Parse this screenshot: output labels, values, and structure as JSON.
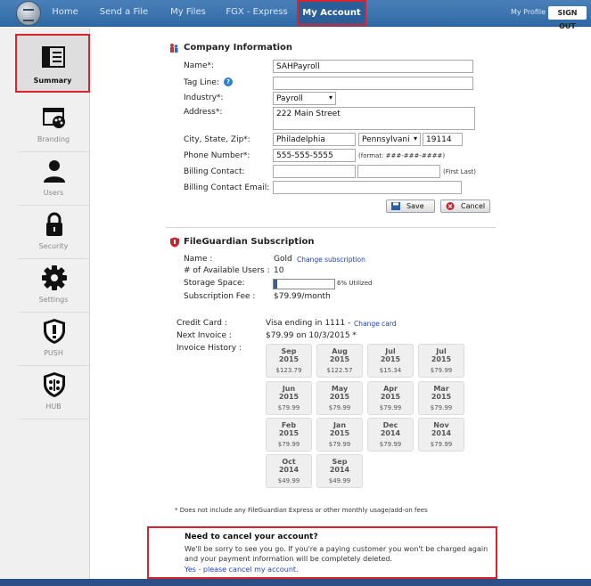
{
  "nav": {
    "items": [
      "Home",
      "Send a File",
      "My Files",
      "FGX - Express",
      "My Account"
    ],
    "active": "My Account",
    "my_profile": "My Profile",
    "sign_out": "SIGN OUT"
  },
  "sidebar": {
    "items": [
      {
        "label": "Summary",
        "icon": "summary-icon"
      },
      {
        "label": "Branding",
        "icon": "branding-icon"
      },
      {
        "label": "Users",
        "icon": "users-icon"
      },
      {
        "label": "Security",
        "icon": "lock-icon"
      },
      {
        "label": "Settings",
        "icon": "gear-icon"
      },
      {
        "label": "PUSH",
        "icon": "push-shield-icon"
      },
      {
        "label": "HUB",
        "icon": "hub-shield-icon"
      }
    ]
  },
  "company": {
    "title": "Company Information",
    "name_label": "Name*:",
    "name_value": "SAHPayroll",
    "tagline_label": "Tag Line:",
    "tagline_value": "",
    "industry_label": "Industry*:",
    "industry_value": "Payroll",
    "address_label": "Address*:",
    "address_value": "222 Main Street",
    "city_label": "City, State, Zip*:",
    "city_value": "Philadelphia",
    "state_value": "Pennsylvani",
    "zip_value": "19114",
    "phone_label": "Phone Number*:",
    "phone_value": "555-555-5555",
    "phone_hint": "(format: ###-###-####)",
    "billing_contact_label": "Billing Contact:",
    "billing_contact_hint": "(First Last)",
    "billing_email_label": "Billing Contact Email:",
    "save_label": "Save",
    "cancel_label": "Cancel"
  },
  "subscription": {
    "title": "FileGuardian Subscription",
    "name_label": "Name :",
    "name_value": "Gold",
    "change_link": "Change subscription",
    "users_label": "# of Available Users :",
    "users_value": "10",
    "storage_label": "Storage Space:",
    "storage_fraction": 0.06,
    "storage_text": "6% Utilized",
    "fee_label": "Subscription Fee :",
    "fee_value": "$79.99/month",
    "card_label": "Credit Card :",
    "card_value": "Visa ending in 1111 -",
    "card_link": "Change card",
    "next_label": "Next Invoice :",
    "next_value": "$79.99 on 10/3/2015 *",
    "history_label": "Invoice History :"
  },
  "invoices": [
    {
      "month": "Sep",
      "year": "2015",
      "amount": "$123.79"
    },
    {
      "month": "Aug",
      "year": "2015",
      "amount": "$122.57"
    },
    {
      "month": "Jul",
      "year": "2015",
      "amount": "$15.34"
    },
    {
      "month": "Jul",
      "year": "2015",
      "amount": "$79.99"
    },
    {
      "month": "Jun",
      "year": "2015",
      "amount": "$79.99"
    },
    {
      "month": "May",
      "year": "2015",
      "amount": "$79.99"
    },
    {
      "month": "Apr",
      "year": "2015",
      "amount": "$79.99"
    },
    {
      "month": "Mar",
      "year": "2015",
      "amount": "$79.99"
    },
    {
      "month": "Feb",
      "year": "2015",
      "amount": "$79.99"
    },
    {
      "month": "Jan",
      "year": "2015",
      "amount": "$79.99"
    },
    {
      "month": "Dec",
      "year": "2014",
      "amount": "$79.99"
    },
    {
      "month": "Nov",
      "year": "2014",
      "amount": "$79.99"
    },
    {
      "month": "Oct",
      "year": "2014",
      "amount": "$49.99"
    },
    {
      "month": "Sep",
      "year": "2014",
      "amount": "$49.99"
    }
  ],
  "footnote": "* Does not include any FileGuardian Express or other monthly usage/add-on fees",
  "cancel": {
    "title": "Need to cancel your account?",
    "text": "We'll be sorry to see you go. If you're a paying customer you won't be charged again and your payment information will be completely deleted.",
    "link": "Yes - please cancel my account."
  }
}
